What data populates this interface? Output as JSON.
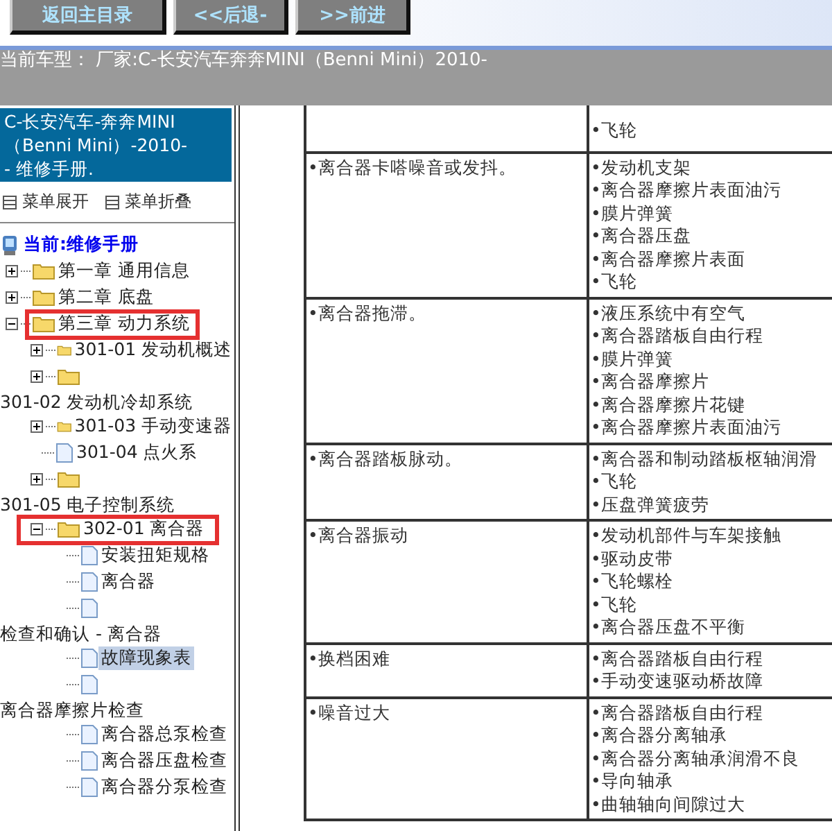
{
  "toolbar": {
    "buttons": [
      {
        "label": "返回主目录"
      },
      {
        "label": "<<后退-"
      },
      {
        "label": ">>前进"
      }
    ]
  },
  "vehicle_bar": {
    "text": "当前车型： 厂家:C-长安汽车奔奔MINI（Benni Mini）2010-"
  },
  "sidebar": {
    "title": "C-长安汽车-奔奔MINI（Benni Mini）-2010-- 维修手册.",
    "menu": [
      {
        "label": "菜单展开"
      },
      {
        "label": "菜单折叠"
      }
    ],
    "tree": {
      "label": "当前:维修手册",
      "children": [
        {
          "label": "第一章 通用信息",
          "kind": "folder",
          "expanded": false,
          "selected": false
        },
        {
          "label": "第二章 底盘",
          "kind": "folder",
          "expanded": false,
          "selected": false
        },
        {
          "label": "第三章 动力系统",
          "kind": "folder",
          "expanded": true,
          "highlighted": true,
          "selected": false,
          "children": [
            {
              "label": "301-01 发动机概述",
              "kind": "folder",
              "expanded": false,
              "selected": false
            },
            {
              "label": "301-02 发动机冷却系统",
              "kind": "folder",
              "expanded": false,
              "label_below": true,
              "selected": false
            },
            {
              "label": "301-03 手动变速器",
              "kind": "folder",
              "expanded": false,
              "selected": false
            },
            {
              "label": "301-04 点火系",
              "kind": "doc",
              "selected": false
            },
            {
              "label": "301-05 电子控制系统",
              "kind": "folder",
              "expanded": false,
              "label_below": true,
              "selected": false
            },
            {
              "label": "302-01 离合器",
              "kind": "folder",
              "expanded": true,
              "highlighted": true,
              "selected": false,
              "children": [
                {
                  "label": "安装扭矩规格",
                  "kind": "doc",
                  "selected": false
                },
                {
                  "label": "离合器",
                  "kind": "doc",
                  "selected": false
                },
                {
                  "label": "检查和确认 - 离合器",
                  "kind": "doc",
                  "label_below": true,
                  "selected": false
                },
                {
                  "label": "故障现象表",
                  "kind": "doc",
                  "selected": true
                },
                {
                  "label": "离合器摩擦片检查",
                  "kind": "doc",
                  "label_below": true,
                  "selected": false
                },
                {
                  "label": "离合器总泵检查",
                  "kind": "doc",
                  "selected": false
                },
                {
                  "label": "离合器压盘检查",
                  "kind": "doc",
                  "selected": false
                },
                {
                  "label": "离合器分泵检查",
                  "kind": "doc",
                  "selected": false
                }
              ]
            }
          ]
        }
      ]
    }
  },
  "table": {
    "rows": [
      {
        "symptom": "",
        "causes": [
          "•飞轮"
        ]
      },
      {
        "symptom": "•离合器卡嗒噪音或发抖。",
        "causes": [
          "•发动机支架",
          "•离合器摩擦片表面油污",
          "•膜片弹簧",
          "•离合器压盘",
          "•离合器摩擦片表面",
          "•飞轮"
        ]
      },
      {
        "symptom": "•离合器拖滞。",
        "causes": [
          "•液压系统中有空气",
          "•离合器踏板自由行程",
          "•膜片弹簧",
          "•离合器摩擦片",
          "•离合器摩擦片花键",
          "•离合器摩擦片表面油污"
        ]
      },
      {
        "symptom": "•离合器踏板脉动。",
        "causes": [
          "•离合器和制动踏板枢轴润滑",
          "•飞轮",
          "•压盘弹簧疲劳"
        ]
      },
      {
        "symptom": "•离合器振动",
        "causes": [
          "•发动机部件与车架接触",
          "•驱动皮带",
          "•飞轮螺栓",
          "•飞轮",
          "•离合器压盘不平衡"
        ]
      },
      {
        "symptom": "•换档困难",
        "causes": [
          "•离合器踏板自由行程",
          "•手动变速驱动桥故障"
        ]
      },
      {
        "symptom": "•噪音过大",
        "causes": [
          "•离合器踏板自由行程",
          "•离合器分离轴承",
          "•离合器分离轴承润滑不良",
          "•导向轴承",
          "•曲轴轴向间隙过大"
        ]
      }
    ]
  }
}
